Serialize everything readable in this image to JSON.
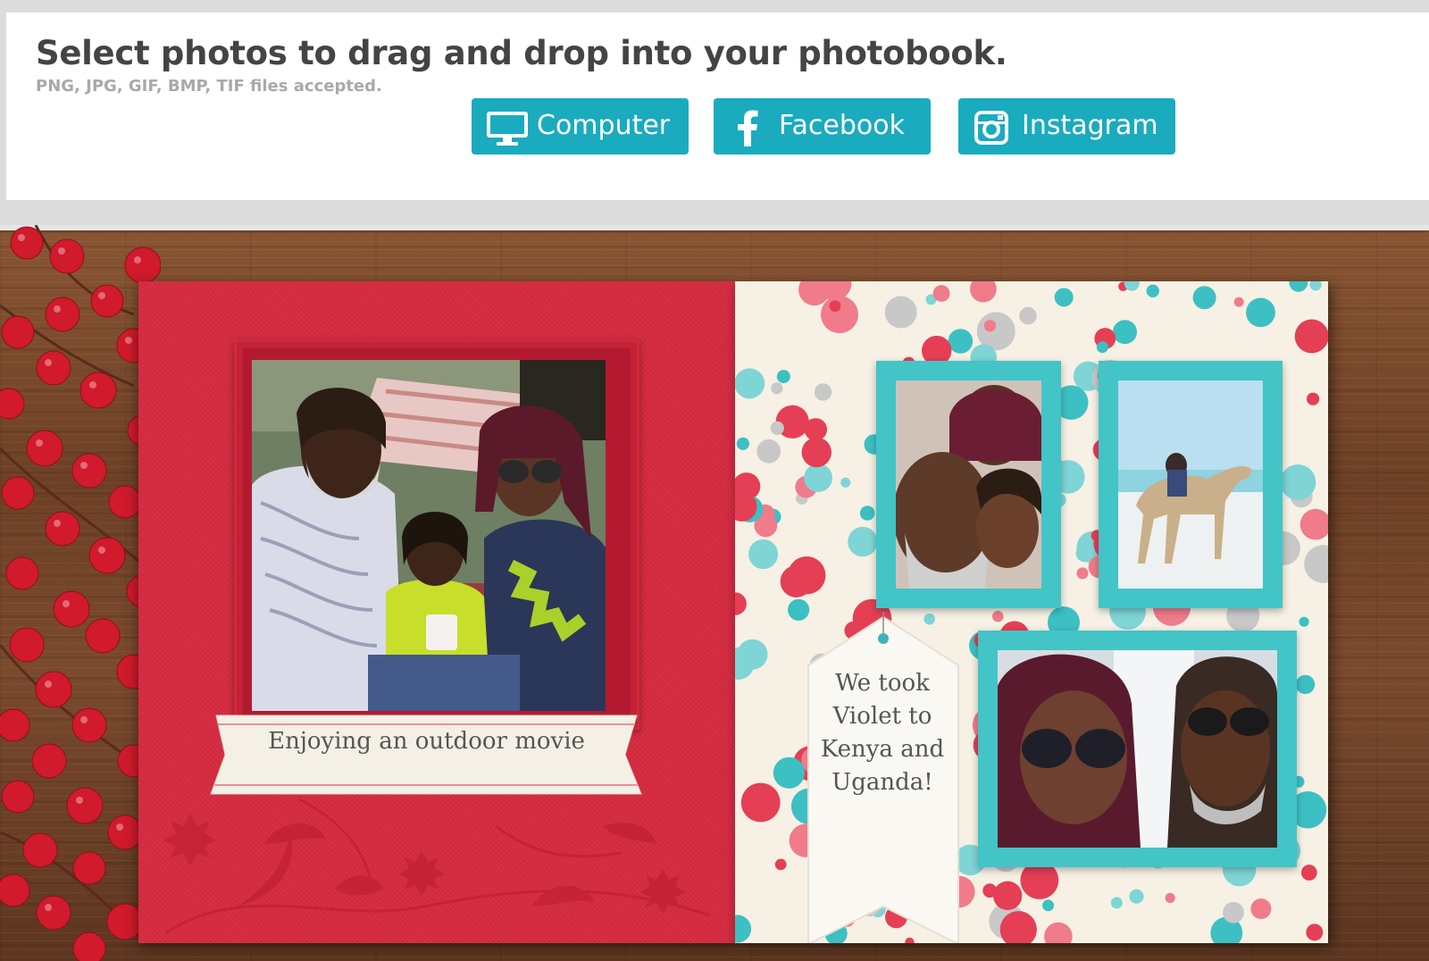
{
  "header": {
    "title": "Select photos to drag and drop into your photobook.",
    "formats": "PNG, JPG, GIF, BMP, TIF files accepted."
  },
  "sources": {
    "computer": {
      "label": "Computer",
      "icon": "monitor-icon"
    },
    "facebook": {
      "label": "Facebook",
      "icon": "facebook-icon"
    },
    "instagram": {
      "label": "Instagram",
      "icon": "instagram-icon"
    }
  },
  "left_page": {
    "caption": "Enjoying an outdoor movie",
    "background_color": "#d52b40"
  },
  "right_page": {
    "tag_lines": [
      "We took",
      "Violet to",
      "Kenya and",
      "Uganda!"
    ],
    "frame_color": "#43c4c7",
    "background_color": "#f6f1e4"
  },
  "colors": {
    "button": "#1aabbf",
    "title": "#444444",
    "formats": "#a9a9a9"
  }
}
